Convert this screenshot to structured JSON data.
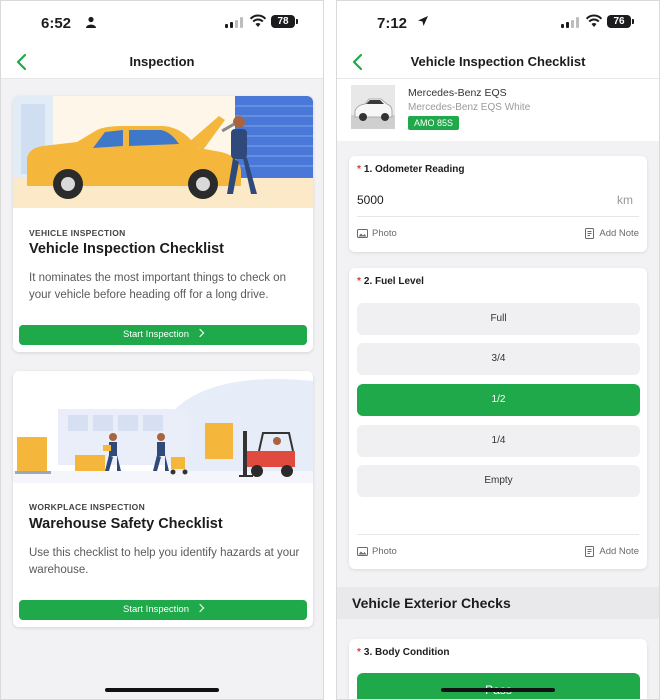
{
  "left": {
    "status": {
      "time": "6:52",
      "battery": "78"
    },
    "nav": {
      "title": "Inspection"
    },
    "cards": [
      {
        "category": "VEHICLE INSPECTION",
        "title": "Vehicle Inspection Checklist",
        "description": "It nominates the most important things to check on your vehicle before heading off for a long drive.",
        "button": "Start Inspection"
      },
      {
        "category": "WORKPLACE INSPECTION",
        "title": "Warehouse Safety Checklist",
        "description": "Use this checklist to help you identify hazards at your warehouse.",
        "button": "Start Inspection"
      }
    ]
  },
  "right": {
    "status": {
      "time": "7:12",
      "battery": "76"
    },
    "nav": {
      "title": "Vehicle Inspection Checklist"
    },
    "vehicle": {
      "name": "Mercedes-Benz EQS",
      "subtitle": "Mercedes-Benz EQS White",
      "plate": "AMO 85S"
    },
    "odometer": {
      "number": "1.",
      "title": "Odometer Reading",
      "value": "5000",
      "unit": "km",
      "photo": "Photo",
      "note": "Add Note"
    },
    "fuel": {
      "number": "2.",
      "title": "Fuel Level",
      "options": [
        "Full",
        "3/4",
        "1/2",
        "1/4",
        "Empty"
      ],
      "selected": "1/2",
      "photo": "Photo",
      "note": "Add Note"
    },
    "section": "Vehicle Exterior Checks",
    "body": {
      "number": "3.",
      "title": "Body Condition",
      "button": "Pass"
    }
  },
  "colors": {
    "accent": "#20a94a",
    "required": "#e53935"
  }
}
